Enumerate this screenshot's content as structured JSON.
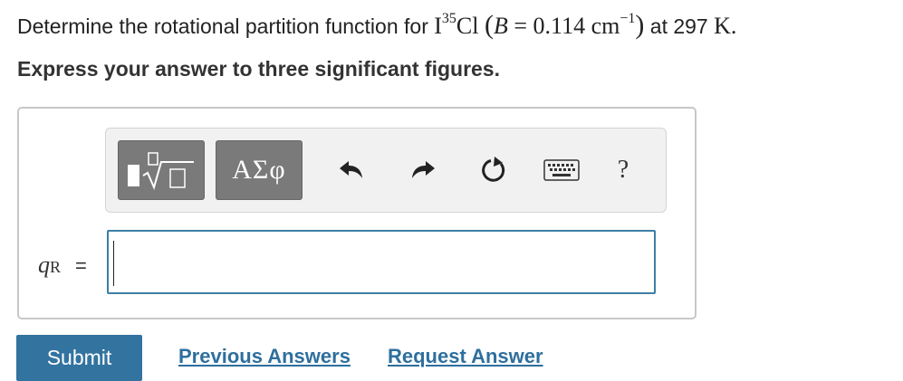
{
  "question": {
    "prefix": "Determine the rotational partition function for ",
    "molecule_base": "I",
    "molecule_isotope": "35",
    "molecule_rest": "Cl",
    "param_open": "(",
    "param_symbol": "B",
    "param_eq": " = 0.114 cm",
    "param_exp": "−1",
    "param_close": ")",
    "suffix": " at 297 ",
    "unit": "K."
  },
  "instruction": "Express your answer to three significant figures.",
  "toolbar": {
    "templates_icon": "fraction-radical-template-icon",
    "greek_label": "ΑΣφ",
    "undo_icon": "undo-icon",
    "redo_icon": "redo-icon",
    "reset_icon": "reset-icon",
    "keyboard_icon": "keyboard-icon",
    "help_label": "?"
  },
  "answer": {
    "label_var": "q",
    "label_sub": "R",
    "label_eq": "=",
    "value": ""
  },
  "actions": {
    "submit": "Submit",
    "previous": "Previous Answers",
    "request": "Request Answer"
  },
  "colors": {
    "accent": "#3273a0",
    "link": "#2e6f9e",
    "input_border": "#3d7fa6",
    "template_button": "#7a7a7a"
  }
}
